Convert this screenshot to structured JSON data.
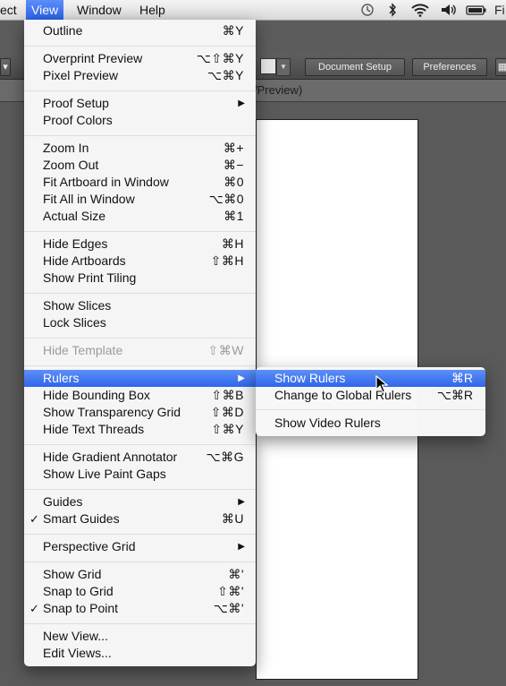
{
  "menubar": {
    "items": [
      "ect",
      "View",
      "Window",
      "Help"
    ],
    "status_right": "Fi",
    "icons": [
      "time-machine-icon",
      "bluetooth-icon",
      "wifi-icon",
      "volume-icon",
      "battery-icon"
    ]
  },
  "toolbar": {
    "document_setup": "Document Setup",
    "preferences": "Preferences"
  },
  "tab": {
    "title": "/Preview)"
  },
  "menu": {
    "items": [
      {
        "label": "Outline",
        "shortcut": "⌘Y"
      },
      {
        "label": "Overprint Preview",
        "shortcut": "⌥⇧⌘Y"
      },
      {
        "label": "Pixel Preview",
        "shortcut": "⌥⌘Y"
      },
      {
        "label": "Proof Setup",
        "shortcut": ""
      },
      {
        "label": "Proof Colors",
        "shortcut": ""
      },
      {
        "label": "Zoom In",
        "shortcut": "⌘+"
      },
      {
        "label": "Zoom Out",
        "shortcut": "⌘−"
      },
      {
        "label": "Fit Artboard in Window",
        "shortcut": "⌘0"
      },
      {
        "label": "Fit All in Window",
        "shortcut": "⌥⌘0"
      },
      {
        "label": "Actual Size",
        "shortcut": "⌘1"
      },
      {
        "label": "Hide Edges",
        "shortcut": "⌘H"
      },
      {
        "label": "Hide Artboards",
        "shortcut": "⇧⌘H"
      },
      {
        "label": "Show Print Tiling",
        "shortcut": ""
      },
      {
        "label": "Show Slices",
        "shortcut": ""
      },
      {
        "label": "Lock Slices",
        "shortcut": ""
      },
      {
        "label": "Hide Template",
        "shortcut": "⇧⌘W"
      },
      {
        "label": "Rulers",
        "shortcut": ""
      },
      {
        "label": "Hide Bounding Box",
        "shortcut": "⇧⌘B"
      },
      {
        "label": "Show Transparency Grid",
        "shortcut": "⇧⌘D"
      },
      {
        "label": "Hide Text Threads",
        "shortcut": "⇧⌘Y"
      },
      {
        "label": "Hide Gradient Annotator",
        "shortcut": "⌥⌘G"
      },
      {
        "label": "Show Live Paint Gaps",
        "shortcut": ""
      },
      {
        "label": "Guides",
        "shortcut": ""
      },
      {
        "label": "Smart Guides",
        "shortcut": "⌘U"
      },
      {
        "label": "Perspective Grid",
        "shortcut": ""
      },
      {
        "label": "Show Grid",
        "shortcut": "⌘'"
      },
      {
        "label": "Snap to Grid",
        "shortcut": "⇧⌘'"
      },
      {
        "label": "Snap to Point",
        "shortcut": "⌥⌘'"
      },
      {
        "label": "New View...",
        "shortcut": ""
      },
      {
        "label": "Edit Views...",
        "shortcut": ""
      }
    ]
  },
  "submenu": {
    "items": [
      {
        "label": "Show Rulers",
        "shortcut": "⌘R"
      },
      {
        "label": "Change to Global Rulers",
        "shortcut": "⌥⌘R"
      },
      {
        "label": "Show Video Rulers",
        "shortcut": ""
      }
    ]
  },
  "colors": {
    "highlight": "#3d74f0",
    "menu_bg": "#f7f7f7",
    "disabled": "#9b9b9b"
  }
}
